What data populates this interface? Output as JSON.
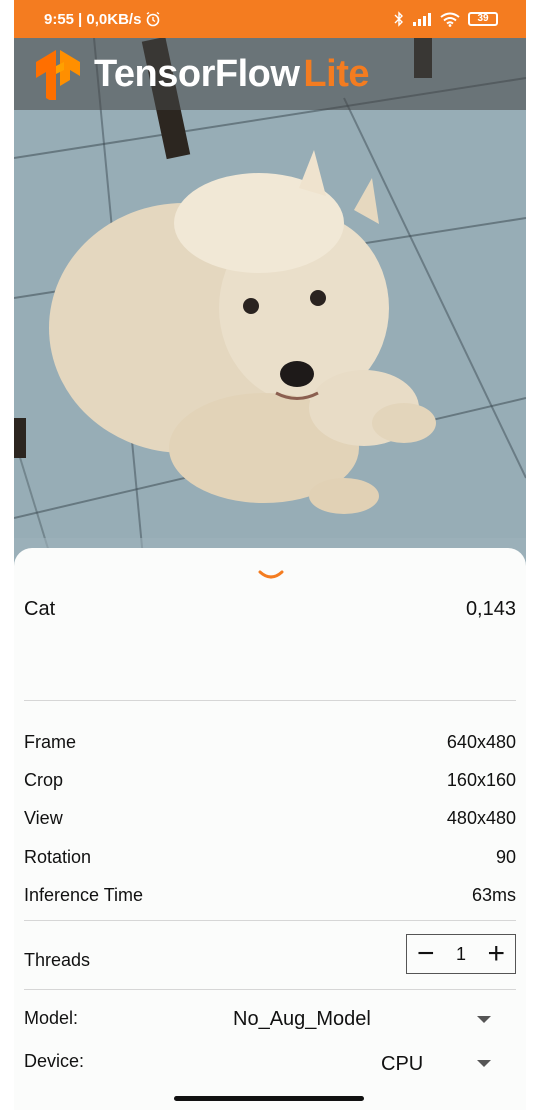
{
  "status_bar": {
    "time": "9:55",
    "network_speed": "| 0,0KB/s",
    "battery_level": "39",
    "icons": [
      "alarm-icon",
      "bluetooth-icon",
      "signal-icon",
      "wifi-icon",
      "battery-icon"
    ]
  },
  "app_bar": {
    "brand_primary": "TensorFlow",
    "brand_secondary": "Lite",
    "logo_icon": "tensorflow-logo",
    "accent_color": "#f47c20"
  },
  "result": {
    "label": "Cat",
    "score": "0,143"
  },
  "info": {
    "frame": {
      "label": "Frame",
      "value": "640x480"
    },
    "crop": {
      "label": "Crop",
      "value": "160x160"
    },
    "view": {
      "label": "View",
      "value": "480x480"
    },
    "rotation": {
      "label": "Rotation",
      "value": "90"
    },
    "inference": {
      "label": "Inference Time",
      "value": "63ms"
    }
  },
  "threads": {
    "label": "Threads",
    "value": "1",
    "decrement": "−",
    "increment": "+"
  },
  "model": {
    "label": "Model:",
    "selected": "No_Aug_Model"
  },
  "device": {
    "label": "Device:",
    "selected": "CPU"
  }
}
